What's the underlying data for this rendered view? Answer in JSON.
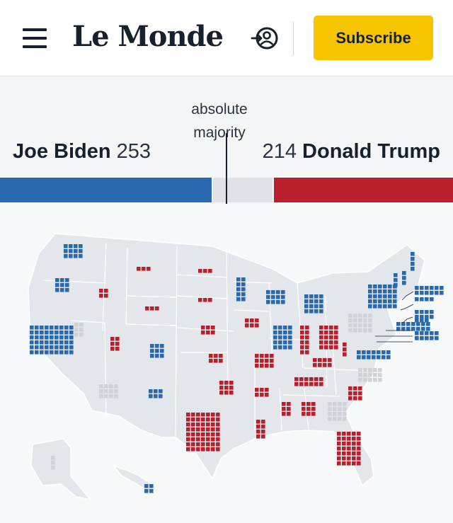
{
  "header": {
    "logo_text": "Le Monde",
    "subscribe_label": "Subscribe",
    "menu_icon": "hamburger-menu-icon",
    "account_icon": "account-icon"
  },
  "results": {
    "majority_label_line1": "absolute",
    "majority_label_line2": "majority",
    "candidates": [
      {
        "name": "Joe Biden",
        "votes": "253",
        "color": "#2a69b0"
      },
      {
        "name": "Donald Trump",
        "votes": "214",
        "color": "#b9202d"
      }
    ],
    "total_electoral_votes": 538,
    "undecided_color": "#dfe2e6"
  },
  "map": {
    "colors": {
      "dem": "#2a69b0",
      "rep": "#b9202d",
      "undecided": "#cfd3d8",
      "land": "#e3e6ea"
    },
    "states": [
      {
        "id": "WA",
        "party": "dem",
        "cols": 4,
        "rows": 3
      },
      {
        "id": "OR",
        "party": "dem",
        "cols": 3,
        "rows": 3
      },
      {
        "id": "CA",
        "party": "dem",
        "cols": 9,
        "rows": 6
      },
      {
        "id": "ID",
        "party": "rep",
        "cols": 2,
        "rows": 2
      },
      {
        "id": "MT",
        "party": "rep",
        "cols": 3,
        "rows": 1
      },
      {
        "id": "NV",
        "party": "undecided",
        "cols": 2,
        "rows": 3
      },
      {
        "id": "WY",
        "party": "rep",
        "cols": 3,
        "rows": 1
      },
      {
        "id": "UT",
        "party": "rep",
        "cols": 2,
        "rows": 3
      },
      {
        "id": "CO",
        "party": "dem",
        "cols": 3,
        "rows": 3
      },
      {
        "id": "AZ",
        "party": "undecided",
        "cols": 4,
        "rows": 3
      },
      {
        "id": "NM",
        "party": "dem",
        "cols": 3,
        "rows": 2
      },
      {
        "id": "ND",
        "party": "rep",
        "cols": 3,
        "rows": 1
      },
      {
        "id": "SD",
        "party": "rep",
        "cols": 3,
        "rows": 1
      },
      {
        "id": "NE",
        "party": "rep",
        "cols": 3,
        "rows": 2
      },
      {
        "id": "KS",
        "party": "rep",
        "cols": 3,
        "rows": 2
      },
      {
        "id": "OK",
        "party": "rep",
        "cols": 3,
        "rows": 3
      },
      {
        "id": "TX",
        "party": "rep",
        "cols": 7,
        "rows": 8
      },
      {
        "id": "MN",
        "party": "dem",
        "cols": 2,
        "rows": 5
      },
      {
        "id": "IA",
        "party": "rep",
        "cols": 3,
        "rows": 2
      },
      {
        "id": "MO",
        "party": "rep",
        "cols": 4,
        "rows": 3
      },
      {
        "id": "AR",
        "party": "rep",
        "cols": 3,
        "rows": 2
      },
      {
        "id": "LA",
        "party": "rep",
        "cols": 2,
        "rows": 4
      },
      {
        "id": "WI",
        "party": "dem",
        "cols": 4,
        "rows": 3
      },
      {
        "id": "IL",
        "party": "dem",
        "cols": 4,
        "rows": 5
      },
      {
        "id": "MI",
        "party": "dem",
        "cols": 4,
        "rows": 4
      },
      {
        "id": "IN",
        "party": "rep",
        "cols": 2,
        "rows": 6
      },
      {
        "id": "OH",
        "party": "rep",
        "cols": 4,
        "rows": 5
      },
      {
        "id": "KY",
        "party": "rep",
        "cols": 4,
        "rows": 2
      },
      {
        "id": "TN",
        "party": "rep",
        "cols": 6,
        "rows": 2
      },
      {
        "id": "MS",
        "party": "rep",
        "cols": 2,
        "rows": 3
      },
      {
        "id": "AL",
        "party": "rep",
        "cols": 3,
        "rows": 3
      },
      {
        "id": "GA",
        "party": "undecided",
        "cols": 4,
        "rows": 4
      },
      {
        "id": "FL",
        "party": "rep",
        "cols": 5,
        "rows": 7
      },
      {
        "id": "SC",
        "party": "rep",
        "cols": 3,
        "rows": 3
      },
      {
        "id": "NC",
        "party": "undecided",
        "cols": 5,
        "rows": 3
      },
      {
        "id": "VA",
        "party": "dem",
        "cols": 7,
        "rows": 2
      },
      {
        "id": "WV",
        "party": "rep",
        "cols": 1,
        "rows": 3
      },
      {
        "id": "PA",
        "party": "undecided",
        "cols": 5,
        "rows": 4
      },
      {
        "id": "NY",
        "party": "dem",
        "cols": 6,
        "rows": 5
      },
      {
        "id": "ME",
        "party": "dem",
        "cols": 1,
        "rows": 4
      },
      {
        "id": "NH",
        "party": "dem",
        "cols": 1,
        "rows": 3
      },
      {
        "id": "VT",
        "party": "dem",
        "cols": 1,
        "rows": 3
      },
      {
        "id": "MA",
        "party": "dem",
        "cols": 6,
        "rows": 2
      },
      {
        "id": "RI",
        "party": "dem",
        "cols": 4,
        "rows": 1
      },
      {
        "id": "CT",
        "party": "dem",
        "cols": 4,
        "rows": 2
      },
      {
        "id": "NJ",
        "party": "dem",
        "cols": 7,
        "rows": 2
      },
      {
        "id": "DE",
        "party": "dem",
        "cols": 3,
        "rows": 1
      },
      {
        "id": "MD",
        "party": "dem",
        "cols": 5,
        "rows": 2
      },
      {
        "id": "DC",
        "party": "dem",
        "cols": 3,
        "rows": 1
      },
      {
        "id": "AK",
        "party": "undecided",
        "cols": 1,
        "rows": 3
      },
      {
        "id": "HI",
        "party": "dem",
        "cols": 2,
        "rows": 2
      }
    ]
  }
}
